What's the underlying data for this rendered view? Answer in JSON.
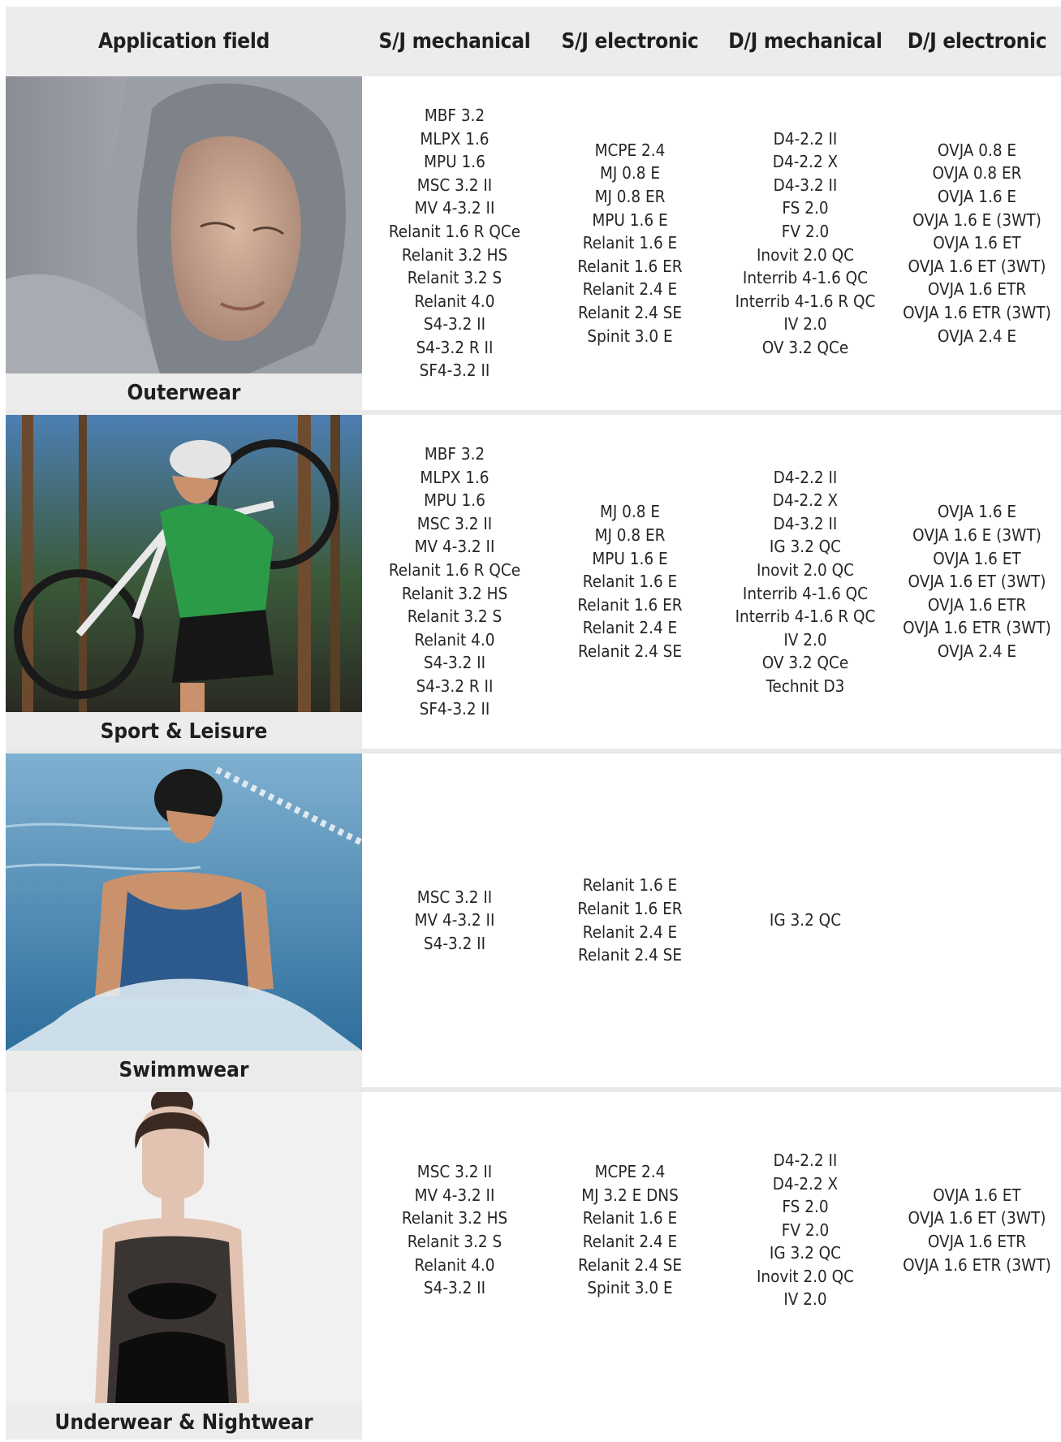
{
  "headers": [
    "Application field",
    "S/J mechanical",
    "S/J electronic",
    "D/J mechanical",
    "D/J electronic"
  ],
  "rows": [
    {
      "field": "Outerwear",
      "photo": "woman-in-grey-hood-photo",
      "sj_mechanical": [
        "MBF 3.2",
        "MLPX 1.6",
        "MPU 1.6",
        "MSC 3.2 II",
        "MV 4-3.2 II",
        "Relanit 1.6 R QCe",
        "Relanit 3.2 HS",
        "Relanit 3.2 S",
        "Relanit 4.0",
        "S4-3.2 II",
        "S4-3.2 R II",
        "SF4-3.2 II"
      ],
      "sj_electronic": [
        "MCPE 2.4",
        "MJ 0.8 E",
        "MJ 0.8 ER",
        "MPU 1.6 E",
        "Relanit 1.6 E",
        "Relanit 1.6 ER",
        "Relanit 2.4 E",
        "Relanit 2.4 SE",
        "Spinit 3.0 E"
      ],
      "dj_mechanical": [
        "D4-2.2 II",
        "D4-2.2 X",
        "D4-3.2 II",
        "FS 2.0",
        "FV 2.0",
        "Inovit 2.0 QC",
        "Interrib 4-1.6 QC",
        "Interrib 4-1.6 R QC",
        "IV 2.0",
        "OV 3.2 QCe"
      ],
      "dj_electronic": [
        "OVJA 0.8 E",
        "OVJA 0.8 ER",
        "OVJA 1.6 E",
        "OVJA 1.6 E (3WT)",
        "OVJA 1.6 ET",
        "OVJA 1.6 ET (3WT)",
        "OVJA 1.6 ETR",
        "OVJA 1.6 ETR (3WT)",
        "OVJA 2.4 E"
      ]
    },
    {
      "field": "Sport & Leisure",
      "photo": "cyclist-carrying-bike-photo",
      "sj_mechanical": [
        "MBF 3.2",
        "MLPX 1.6",
        "MPU 1.6",
        "MSC 3.2 II",
        "MV 4-3.2 II",
        "Relanit 1.6 R QCe",
        "Relanit 3.2 HS",
        "Relanit 3.2 S",
        "Relanit 4.0",
        "S4-3.2 II",
        "S4-3.2 R II",
        "SF4-3.2 II"
      ],
      "sj_electronic": [
        "MJ 0.8 E",
        "MJ 0.8 ER",
        "MPU 1.6 E",
        "Relanit 1.6 E",
        "Relanit 1.6 ER",
        "Relanit 2.4 E",
        "Relanit 2.4 SE"
      ],
      "dj_mechanical": [
        "D4-2.2 II",
        "D4-2.2 X",
        "D4-3.2 II",
        "IG 3.2 QC",
        "Inovit 2.0 QC",
        "Interrib 4-1.6 QC",
        "Interrib 4-1.6 R QC",
        "IV 2.0",
        "OV 3.2 QCe",
        "Technit D3"
      ],
      "dj_electronic": [
        "OVJA 1.6 E",
        "OVJA 1.6 E (3WT)",
        "OVJA 1.6 ET",
        "OVJA 1.6 ET (3WT)",
        "OVJA 1.6 ETR",
        "OVJA 1.6 ETR (3WT)",
        "OVJA 2.4 E"
      ]
    },
    {
      "field": "Swimmwear",
      "photo": "swimmer-in-pool-photo",
      "sj_mechanical": [
        "MSC 3.2 II",
        "MV 4-3.2 II",
        "S4-3.2 II"
      ],
      "sj_electronic": [
        "Relanit 1.6 E",
        "Relanit 1.6 ER",
        "Relanit 2.4 E",
        "Relanit 2.4 SE"
      ],
      "dj_mechanical": [
        "IG 3.2 QC"
      ],
      "dj_electronic": []
    },
    {
      "field": "Underwear & Nightwear",
      "photo": "woman-in-lace-bodysuit-photo",
      "sj_mechanical": [
        "MSC 3.2 II",
        "MV 4-3.2 II",
        "Relanit 3.2 HS",
        "Relanit 3.2 S",
        "Relanit 4.0",
        "S4-3.2 II"
      ],
      "sj_electronic": [
        "MCPE 2.4",
        "MJ 3.2 E DNS",
        "Relanit 1.6 E",
        "Relanit 2.4 E",
        "Relanit 2.4 SE",
        "Spinit 3.0 E"
      ],
      "dj_mechanical": [
        "D4-2.2 II",
        "D4-2.2 X",
        "FS 2.0",
        "FV 2.0",
        "IG 3.2 QC",
        "Inovit 2.0 QC",
        "IV 2.0"
      ],
      "dj_electronic": [
        "OVJA 1.6 ET",
        "OVJA 1.6 ET (3WT)",
        "OVJA 1.6 ETR",
        "OVJA 1.6 ETR (3WT)"
      ]
    }
  ]
}
